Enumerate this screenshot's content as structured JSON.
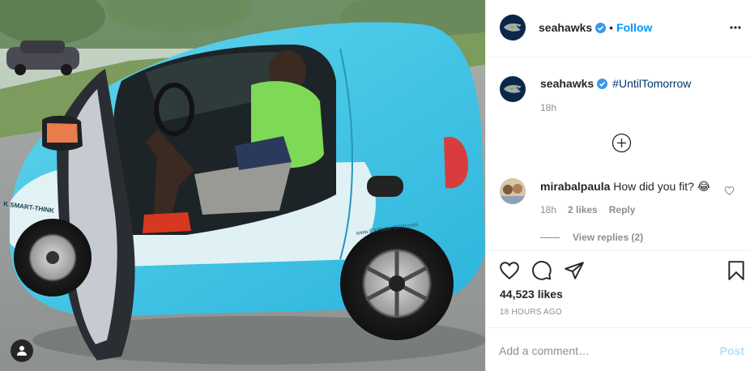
{
  "post": {
    "author": "seahawks",
    "follow_label": "Follow",
    "separator": "•",
    "caption_hashtag": "#UntilTomorrow",
    "caption_time": "18h",
    "likes": "44,523 likes",
    "posted_ago": "18 HOURS AGO"
  },
  "photo": {
    "car_text_side": "K SMART-THINK",
    "car_text_rear": "www.EXITelite DFW.com"
  },
  "comments": [
    {
      "user": "mirabalpaula",
      "text": "How did you fit? 😂",
      "time": "18h",
      "likes": "2 likes",
      "reply_label": "Reply",
      "view_replies": "View replies (2)"
    }
  ],
  "add_comment": {
    "placeholder": "Add a comment…",
    "post_label": "Post"
  },
  "icons": {
    "verified": "verified-badge-icon",
    "more": "more-options-icon",
    "like": "heart-icon",
    "comment": "comment-icon",
    "share": "share-icon",
    "save": "bookmark-icon",
    "load_more": "plus-circle-icon",
    "user_tag": "person-icon"
  },
  "colors": {
    "link_blue": "#0095f6",
    "hashtag": "#00376b",
    "muted": "#8e8e8e",
    "seahawks_navy": "#0b2748",
    "post_disabled": "#b2dffc"
  }
}
